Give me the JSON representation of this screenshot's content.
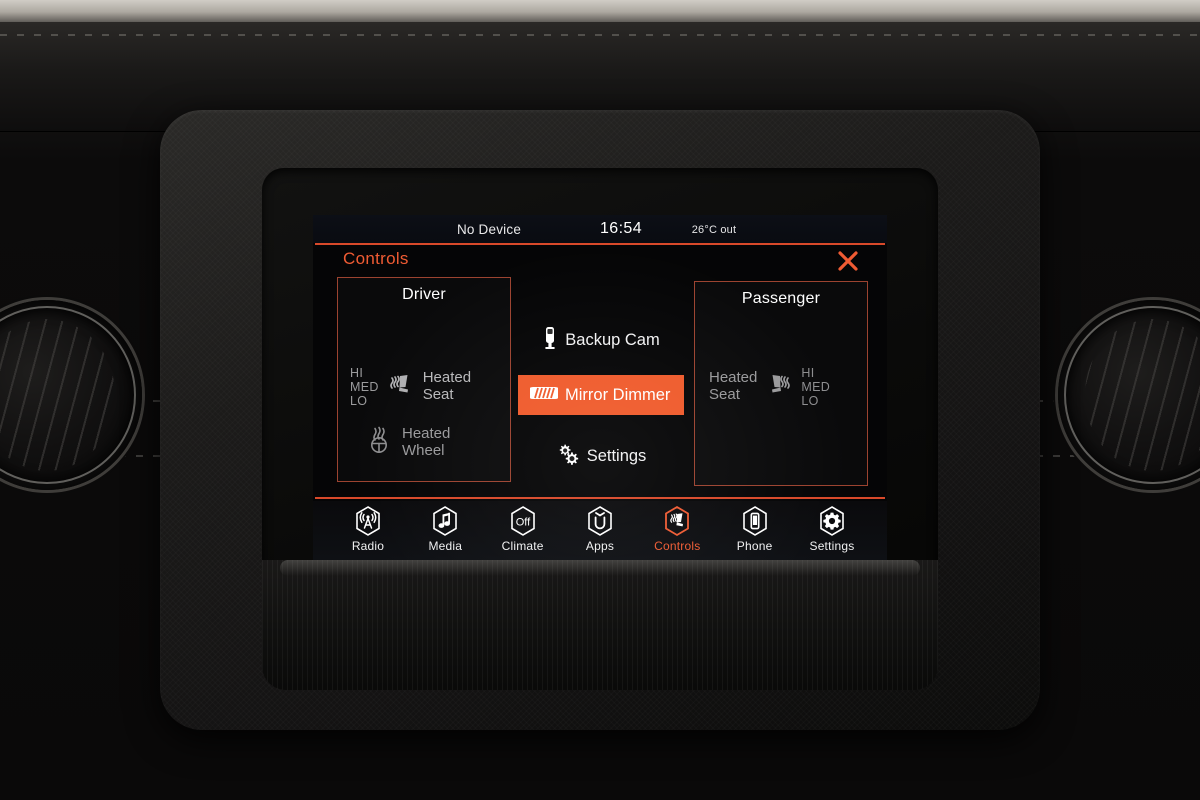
{
  "device": {
    "kind": "car-infotainment-head-unit",
    "accent_color": "#ef5b2c",
    "accent_text_color": "#ef5b33",
    "screen_bg": "#050506"
  },
  "status_bar": {
    "device": "No Device",
    "clock": "16:54",
    "temperature": "26°C out"
  },
  "header": {
    "title": "Controls",
    "close_icon": "close-x-icon"
  },
  "driver_panel": {
    "title": "Driver",
    "heated_seat": {
      "levels": [
        "HI",
        "MED",
        "LO"
      ],
      "label_line1": "Heated",
      "label_line2": "Seat",
      "icon": "heated-seat-icon"
    },
    "heated_wheel": {
      "label_line1": "Heated",
      "label_line2": "Wheel",
      "icon": "heated-steering-wheel-icon"
    }
  },
  "passenger_panel": {
    "title": "Passenger",
    "heated_seat": {
      "levels": [
        "HI",
        "MED",
        "LO"
      ],
      "label_line1": "Heated",
      "label_line2": "Seat",
      "icon": "heated-seat-icon"
    }
  },
  "center_column": {
    "items": [
      {
        "label": "Backup Cam",
        "icon": "backup-camera-icon",
        "selected": false
      },
      {
        "label": "Mirror Dimmer",
        "icon": "mirror-dimmer-icon",
        "selected": true
      },
      {
        "label": "Settings",
        "icon": "gears-icon",
        "selected": false
      }
    ]
  },
  "nav_bar": {
    "items": [
      {
        "label": "Radio",
        "icon": "radio-tower-icon",
        "active": false
      },
      {
        "label": "Media",
        "icon": "music-note-icon",
        "active": false
      },
      {
        "label": "Climate",
        "icon": "climate-off-icon",
        "active": false,
        "badge": "Off"
      },
      {
        "label": "Apps",
        "icon": "uconnect-apps-icon",
        "active": false
      },
      {
        "label": "Controls",
        "icon": "heated-seat-icon",
        "active": true
      },
      {
        "label": "Phone",
        "icon": "phone-icon",
        "active": false
      },
      {
        "label": "Settings",
        "icon": "gear-icon",
        "active": false
      }
    ]
  }
}
